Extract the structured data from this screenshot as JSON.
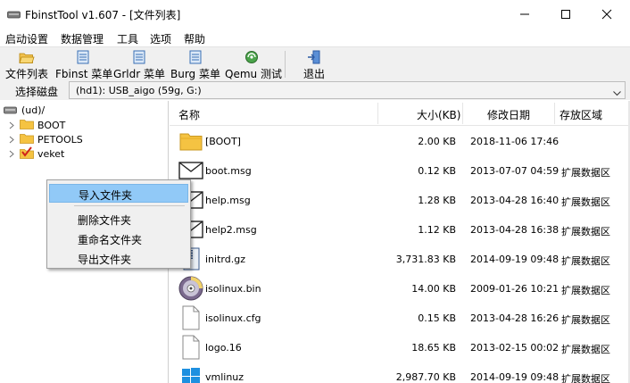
{
  "window": {
    "title": "FbinstTool v1.607 - [文件列表]"
  },
  "menubar": {
    "items": [
      "启动设置",
      "数据管理",
      "工具",
      "选项",
      "帮助"
    ]
  },
  "toolbar": {
    "file_list": "文件列表",
    "fbinst_menu": "Fbinst 菜单",
    "grldr_menu": "Grldr 菜单",
    "burg_menu": "Burg 菜单",
    "qemu_test": "Qemu 测试",
    "exit": "退出"
  },
  "disk": {
    "label": "选择磁盘",
    "value": "(hd1): USB_aigo    (59g, G:)"
  },
  "tree": {
    "root": "(ud)/",
    "nodes": [
      "BOOT",
      "PETOOLS",
      "veket"
    ]
  },
  "columns": {
    "name": "名称",
    "size": "大小(KB)",
    "date": "修改日期",
    "area": "存放区域"
  },
  "files": [
    {
      "icon": "folder-icon",
      "name": "[BOOT]",
      "size": "2.00 KB",
      "date": "2018-11-06 17:46",
      "area": ""
    },
    {
      "icon": "mail-icon",
      "name": "boot.msg",
      "size": "0.12 KB",
      "date": "2013-07-07 04:59",
      "area": "扩展数据区"
    },
    {
      "icon": "mail-icon",
      "name": "help.msg",
      "size": "1.28 KB",
      "date": "2013-04-28 16:40",
      "area": "扩展数据区"
    },
    {
      "icon": "mail-icon",
      "name": "help2.msg",
      "size": "1.12 KB",
      "date": "2013-04-28 16:38",
      "area": "扩展数据区"
    },
    {
      "icon": "archive-icon",
      "name": "initrd.gz",
      "size": "3,731.83 KB",
      "date": "2014-09-19 09:48",
      "area": "扩展数据区"
    },
    {
      "icon": "disc-icon",
      "name": "isolinux.bin",
      "size": "14.00 KB",
      "date": "2009-01-26 10:21",
      "area": "扩展数据区"
    },
    {
      "icon": "file-icon",
      "name": "isolinux.cfg",
      "size": "0.15 KB",
      "date": "2013-04-28 16:26",
      "area": "扩展数据区"
    },
    {
      "icon": "file-icon",
      "name": "logo.16",
      "size": "18.65 KB",
      "date": "2013-02-15 00:02",
      "area": "扩展数据区"
    },
    {
      "icon": "windows-file-icon",
      "name": "vmlinuz",
      "size": "2,987.70 KB",
      "date": "2014-09-19 09:48",
      "area": "扩展数据区"
    }
  ],
  "context_menu": {
    "import": "导入文件夹",
    "delete": "删除文件夹",
    "rename": "重命名文件夹",
    "export": "导出文件夹"
  },
  "colors": {
    "menu_highlight": "#91c9f7",
    "folder": "#f5c342",
    "toolbar_bg": "#f0f0f0"
  }
}
